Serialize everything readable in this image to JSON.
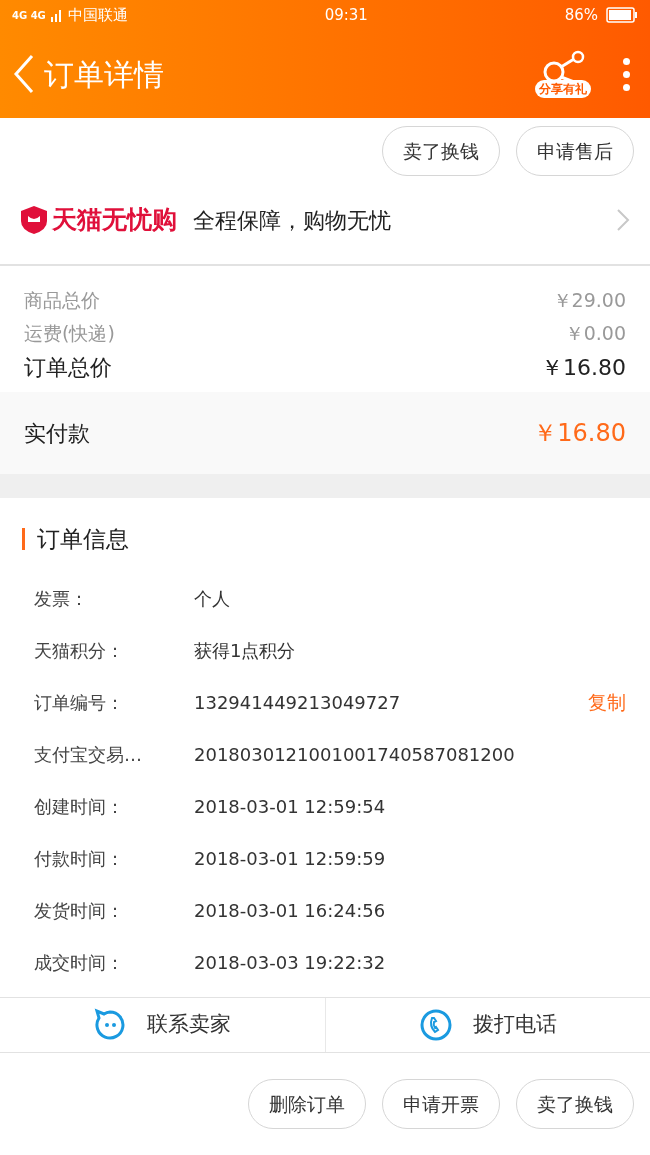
{
  "status_bar": {
    "network": "4G 4G",
    "carrier": "中国联通",
    "time": "09:31",
    "battery": "86%"
  },
  "header": {
    "title": "订单详情",
    "share_badge": "分享有礼"
  },
  "top_actions": [
    "卖了换钱",
    "申请售后"
  ],
  "guarantee": {
    "brand": "天猫无忧购",
    "slogan": "全程保障，购物无忧"
  },
  "prices": [
    {
      "kind": "minor",
      "label": "商品总价",
      "value": "￥29.00"
    },
    {
      "kind": "minor",
      "label": "运费(快递)",
      "value": "￥0.00"
    },
    {
      "kind": "major",
      "label": "订单总价",
      "value": "￥16.80"
    }
  ],
  "paid": {
    "label": "实付款",
    "value": "￥16.80"
  },
  "order_info": {
    "title": "订单信息",
    "rows": [
      {
        "label": "发票：",
        "value": "个人"
      },
      {
        "label": "天猫积分：",
        "value": "获得1点积分"
      },
      {
        "label": "订单编号：",
        "value": "132941449213049727",
        "action": "复制"
      },
      {
        "label": "支付宝交易…",
        "value": "2018030121001001740587081200"
      },
      {
        "label": "创建时间：",
        "value": "2018-03-01 12:59:54"
      },
      {
        "label": "付款时间：",
        "value": "2018-03-01 12:59:59"
      },
      {
        "label": "发货时间：",
        "value": "2018-03-01 16:24:56"
      },
      {
        "label": "成交时间：",
        "value": "2018-03-03 19:22:32"
      }
    ]
  },
  "contact": [
    {
      "kind": "chat",
      "label": "联系卖家"
    },
    {
      "kind": "phone",
      "label": "拨打电话"
    }
  ],
  "bottom_actions": [
    "删除订单",
    "申请开票",
    "卖了换钱"
  ]
}
